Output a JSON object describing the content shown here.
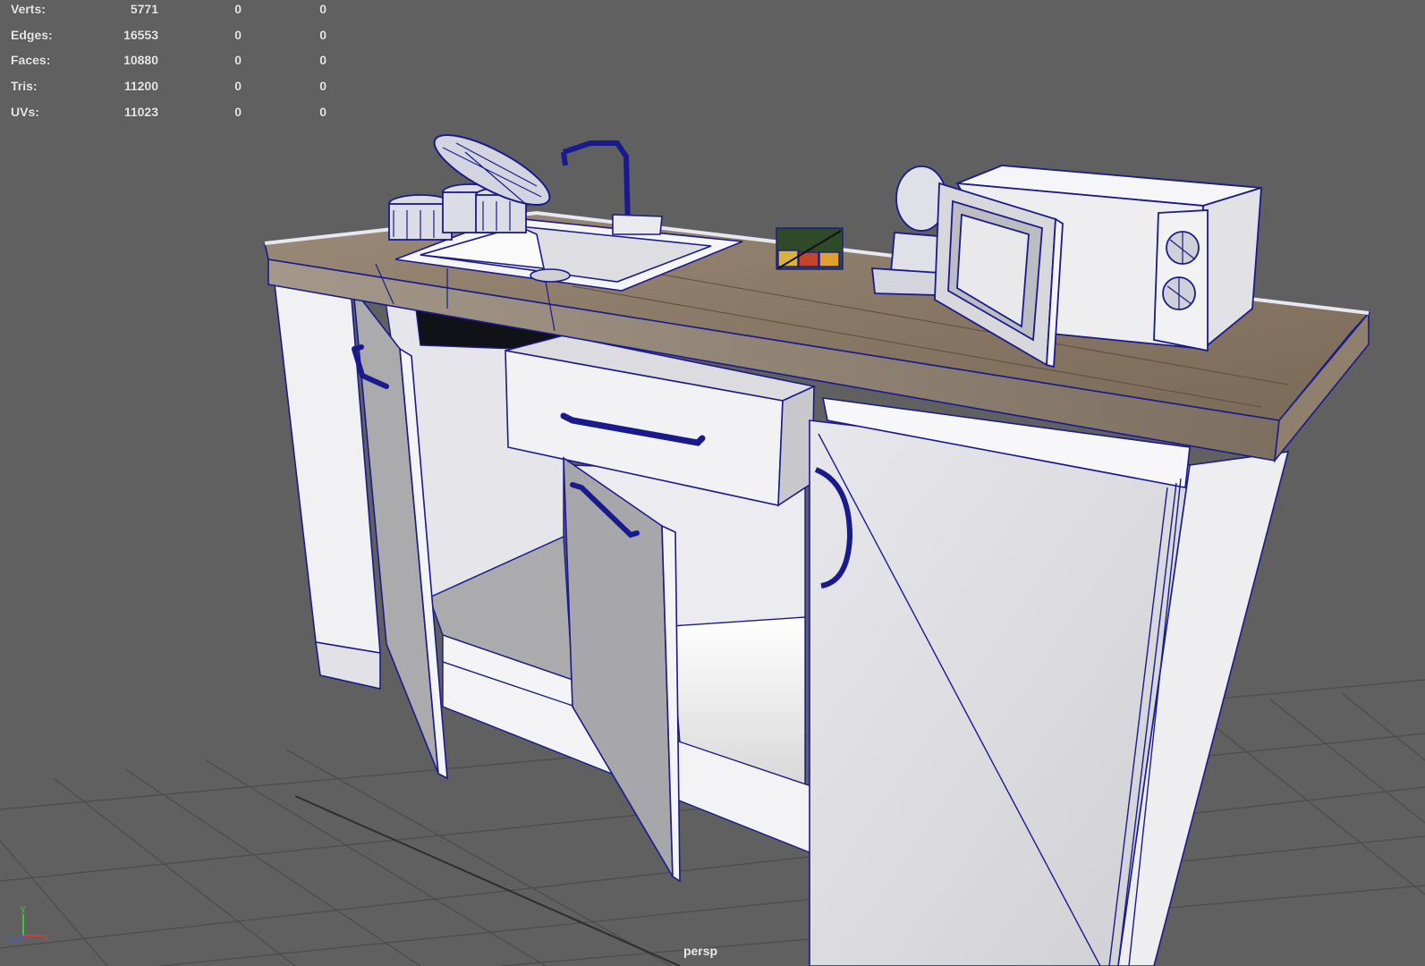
{
  "viewport": {
    "camera": "persp",
    "background": "#606060",
    "wire_color": "#1a1a8c"
  },
  "hud": {
    "stats": [
      {
        "label": "Verts:",
        "v1": "5771",
        "v2": "0",
        "v3": "0"
      },
      {
        "label": "Edges:",
        "v1": "16553",
        "v2": "0",
        "v3": "0"
      },
      {
        "label": "Faces:",
        "v1": "10880",
        "v2": "0",
        "v3": "0"
      },
      {
        "label": "Tris:",
        "v1": "11200",
        "v2": "0",
        "v3": "0"
      },
      {
        "label": "UVs:",
        "v1": "11023",
        "v2": "0",
        "v3": "0"
      }
    ]
  },
  "axis_gizmo": {
    "x": "x",
    "y": "y",
    "z": "z",
    "colors": {
      "x": "#d23c3c",
      "y": "#3cc83c",
      "z": "#3c5ad2"
    }
  },
  "scene": {
    "objects": [
      "kitchen-cabinet",
      "sink",
      "faucet",
      "pot-lid",
      "mugs",
      "microwave",
      "tea-box",
      "drawer",
      "cabinet-doors",
      "countertop"
    ]
  }
}
